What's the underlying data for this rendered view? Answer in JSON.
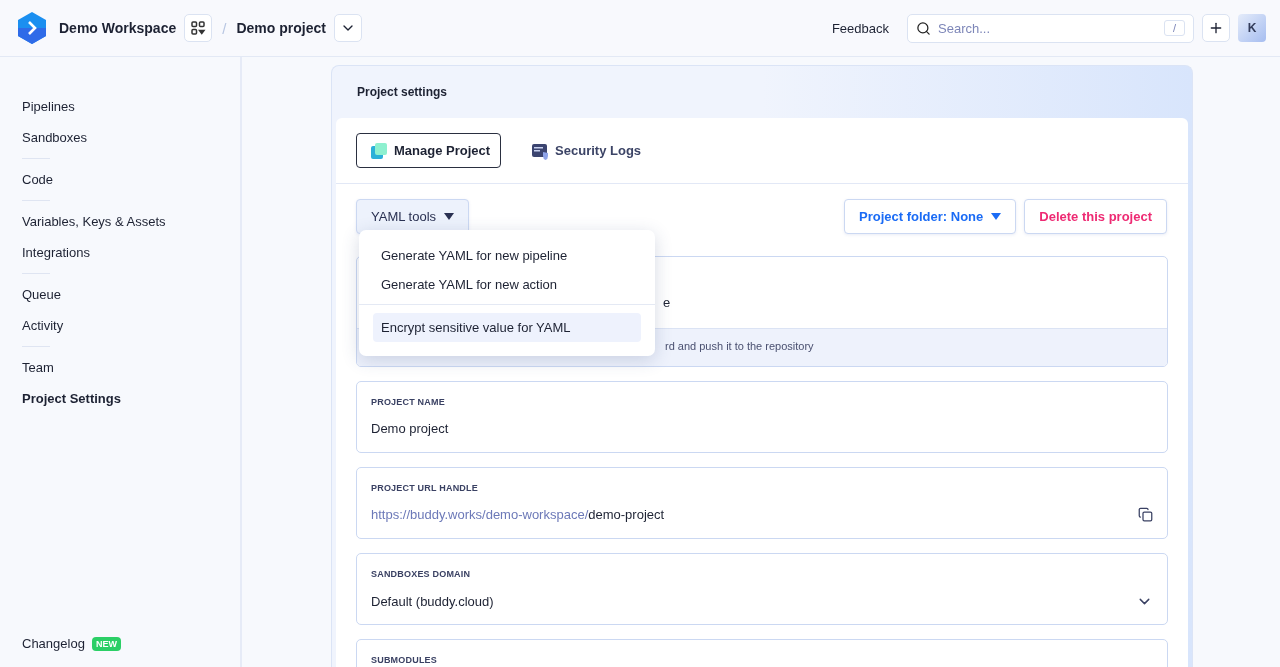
{
  "header": {
    "workspace": "Demo Workspace",
    "separator": "/",
    "project": "Demo project",
    "feedback": "Feedback",
    "search": {
      "placeholder": "Search...",
      "shortcut": "/"
    },
    "avatar": "K"
  },
  "sidebar": {
    "groups": [
      [
        {
          "label": "Pipelines",
          "selected": false
        },
        {
          "label": "Sandboxes",
          "selected": false
        }
      ],
      [
        {
          "label": "Code",
          "selected": false
        }
      ],
      [
        {
          "label": "Variables, Keys & Assets",
          "selected": false
        },
        {
          "label": "Integrations",
          "selected": false
        }
      ],
      [
        {
          "label": "Queue",
          "selected": false
        },
        {
          "label": "Activity",
          "selected": false
        }
      ],
      [
        {
          "label": "Team",
          "selected": false
        },
        {
          "label": "Project Settings",
          "selected": true
        }
      ]
    ],
    "changelog": {
      "label": "Changelog",
      "badge": "NEW"
    }
  },
  "panel": {
    "title": "Project settings",
    "tabs": [
      {
        "label": "Manage Project",
        "selected": true,
        "kind": "manage"
      },
      {
        "label": "Security Logs",
        "selected": false,
        "kind": "logs"
      }
    ],
    "yaml_button": "YAML tools",
    "folder_button": "Project folder: None",
    "delete_button": "Delete this project",
    "menu": {
      "groups": [
        [
          {
            "label": "Generate YAML for new pipeline",
            "selected": false
          },
          {
            "label": "Generate YAML for new action",
            "selected": false
          }
        ],
        [
          {
            "label": "Encrypt sensitive value for YAML",
            "selected": true
          }
        ]
      ]
    },
    "covered_card": {
      "text": "e",
      "footer": "rd and push it to the repository"
    },
    "fields": [
      {
        "kind": "text",
        "label": "PROJECT NAME",
        "value": "Demo project"
      },
      {
        "kind": "url",
        "label": "PROJECT URL HANDLE",
        "prefix": "https://buddy.works/demo-workspace/",
        "value": "demo-project"
      },
      {
        "kind": "select",
        "label": "SANDBOXES DOMAIN",
        "value": "Default (buddy.cloud)"
      },
      {
        "kind": "cut",
        "label": "SUBMODULES"
      }
    ]
  }
}
